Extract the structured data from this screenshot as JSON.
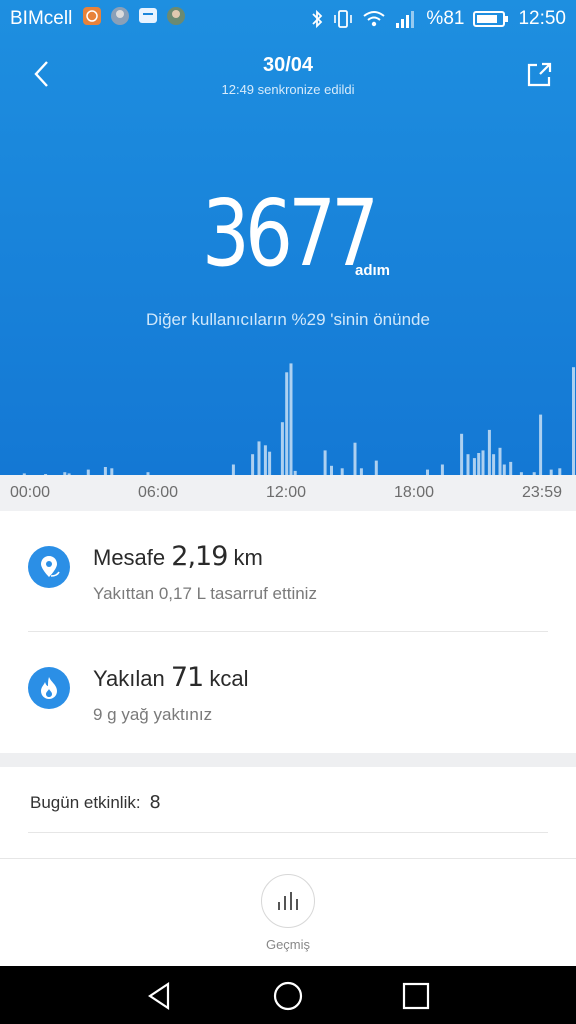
{
  "status_bar": {
    "carrier": "BIMcell",
    "battery": "%81",
    "time": "12:50"
  },
  "header": {
    "date": "30/04",
    "sync_text": "12:49 senkronize edildi"
  },
  "steps": {
    "count": "3677",
    "unit": "adım",
    "rank_text": "Diğer kullanıcıların %29 'sinin önünde"
  },
  "chart_data": {
    "type": "bar",
    "x_ticks": [
      "00:00",
      "06:00",
      "12:00",
      "18:00",
      "23:59"
    ],
    "x_range": [
      0,
      24
    ],
    "bars": [
      {
        "t": 0.6,
        "h": 0.02
      },
      {
        "t": 1.6,
        "h": 0.01
      },
      {
        "t": 2.5,
        "h": 0.03
      },
      {
        "t": 2.7,
        "h": 0.02
      },
      {
        "t": 3.6,
        "h": 0.05
      },
      {
        "t": 4.4,
        "h": 0.07
      },
      {
        "t": 4.7,
        "h": 0.06
      },
      {
        "t": 6.4,
        "h": 0.03
      },
      {
        "t": 10.4,
        "h": 0.09
      },
      {
        "t": 11.3,
        "h": 0.17
      },
      {
        "t": 11.6,
        "h": 0.27
      },
      {
        "t": 11.9,
        "h": 0.24
      },
      {
        "t": 12.1,
        "h": 0.19
      },
      {
        "t": 12.7,
        "h": 0.42
      },
      {
        "t": 12.9,
        "h": 0.81
      },
      {
        "t": 13.1,
        "h": 0.88
      },
      {
        "t": 13.3,
        "h": 0.04
      },
      {
        "t": 14.7,
        "h": 0.2
      },
      {
        "t": 15.0,
        "h": 0.08
      },
      {
        "t": 15.5,
        "h": 0.06
      },
      {
        "t": 16.1,
        "h": 0.26
      },
      {
        "t": 16.4,
        "h": 0.06
      },
      {
        "t": 17.1,
        "h": 0.12
      },
      {
        "t": 19.5,
        "h": 0.05
      },
      {
        "t": 20.2,
        "h": 0.09
      },
      {
        "t": 21.1,
        "h": 0.33
      },
      {
        "t": 21.4,
        "h": 0.17
      },
      {
        "t": 21.7,
        "h": 0.14
      },
      {
        "t": 21.9,
        "h": 0.18
      },
      {
        "t": 22.1,
        "h": 0.2
      },
      {
        "t": 22.4,
        "h": 0.36
      },
      {
        "t": 22.6,
        "h": 0.17
      },
      {
        "t": 22.9,
        "h": 0.22
      },
      {
        "t": 23.1,
        "h": 0.09
      },
      {
        "t": 23.4,
        "h": 0.11
      },
      {
        "t": 23.9,
        "h": 0.03
      },
      {
        "t": 24.5,
        "h": 0.03
      },
      {
        "t": 24.8,
        "h": 0.48
      },
      {
        "t": 25.3,
        "h": 0.05
      },
      {
        "t": 25.7,
        "h": 0.06
      },
      {
        "t": 26.9,
        "h": 0.85
      }
    ]
  },
  "distance": {
    "label": "Mesafe",
    "value": "2,19",
    "unit": "km",
    "note": "Yakıttan 0,17 L tasarruf ettiniz"
  },
  "calories": {
    "label": "Yakılan",
    "value": "71",
    "unit": "kcal",
    "note": "9 g yağ yaktınız"
  },
  "activity": {
    "label": "Bugün etkinlik:",
    "value": "8"
  },
  "history": {
    "label": "Geçmiş"
  },
  "colors": {
    "header_bg": "#1a86dc",
    "accent": "#2b8fe6"
  }
}
